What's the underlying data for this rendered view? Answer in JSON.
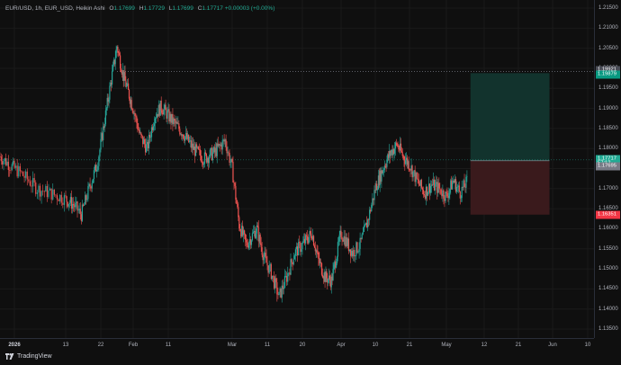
{
  "legend": {
    "symbol": "EUR/USD, 1h, EUR_USD, Heikin Ashi",
    "o_label": "O",
    "o_value": "1.17699",
    "h_label": "H",
    "h_value": "1.17729",
    "l_label": "L",
    "l_value": "1.17699",
    "c_label": "C",
    "c_value": "1.17717",
    "change": "+0.00003 (+0.00%)"
  },
  "y_ticks": [
    "1.21500",
    "1.21000",
    "1.20500",
    "1.20000",
    "1.19500",
    "1.19000",
    "1.18500",
    "1.18000",
    "1.17500",
    "1.17000",
    "1.16500",
    "1.16000",
    "1.15500",
    "1.15000",
    "1.14500",
    "1.14000",
    "1.13500"
  ],
  "x_ticks": [
    "2026",
    "13",
    "22",
    "Feb",
    "11",
    "Mar",
    "11",
    "20",
    "Apr",
    "10",
    "21",
    "May",
    "12",
    "21",
    "Jun",
    "10"
  ],
  "price_tags": {
    "target_top": "1.19921",
    "target": "1.19879",
    "current": "1.17717",
    "countdown": "57:12",
    "entry": "1.17695",
    "stop": "1.16351"
  },
  "colors": {
    "up": "#26a69a",
    "down": "#ef5350",
    "profit_zone": "#12332d",
    "loss_zone": "#3a1a1c",
    "current_tag": "#22ab94",
    "stop_tag": "#f23645",
    "entry_tag": "#787b86"
  },
  "branding": {
    "name": "TradingView"
  },
  "chart_data": {
    "type": "candlestick",
    "style": "Heikin Ashi",
    "symbol": "EUR/USD",
    "interval": "1h",
    "ylim": [
      1.135,
      1.215
    ],
    "trend_points": [
      [
        "2026-01-01",
        1.178
      ],
      [
        "2026-01-05",
        1.174
      ],
      [
        "2026-01-08",
        1.17
      ],
      [
        "2026-01-12",
        1.168
      ],
      [
        "2026-01-15",
        1.166
      ],
      [
        "2026-01-17",
        1.1635
      ],
      [
        "2026-01-19",
        1.17
      ],
      [
        "2026-01-21",
        1.176
      ],
      [
        "2026-01-23",
        1.186
      ],
      [
        "2026-01-25",
        1.196
      ],
      [
        "2026-01-27",
        1.2055
      ],
      [
        "2026-01-29",
        1.198
      ],
      [
        "2026-02-01",
        1.19
      ],
      [
        "2026-02-03",
        1.183
      ],
      [
        "2026-02-05",
        1.18
      ],
      [
        "2026-02-07",
        1.188
      ],
      [
        "2026-02-09",
        1.1905
      ],
      [
        "2026-02-12",
        1.187
      ],
      [
        "2026-02-15",
        1.184
      ],
      [
        "2026-02-18",
        1.18
      ],
      [
        "2026-02-21",
        1.1775
      ],
      [
        "2026-02-24",
        1.179
      ],
      [
        "2026-02-27",
        1.182
      ],
      [
        "2026-03-01",
        1.175
      ],
      [
        "2026-03-03",
        1.161
      ],
      [
        "2026-03-05",
        1.156
      ],
      [
        "2026-03-08",
        1.16
      ],
      [
        "2026-03-10",
        1.153
      ],
      [
        "2026-03-12",
        1.149
      ],
      [
        "2026-03-14",
        1.143
      ],
      [
        "2026-03-16",
        1.148
      ],
      [
        "2026-03-18",
        1.154
      ],
      [
        "2026-03-20",
        1.156
      ],
      [
        "2026-03-23",
        1.159
      ],
      [
        "2026-03-25",
        1.152
      ],
      [
        "2026-03-27",
        1.148
      ],
      [
        "2026-03-29",
        1.147
      ],
      [
        "2026-04-01",
        1.159
      ],
      [
        "2026-04-04",
        1.154
      ],
      [
        "2026-04-06",
        1.156
      ],
      [
        "2026-04-08",
        1.162
      ],
      [
        "2026-04-10",
        1.17
      ],
      [
        "2026-04-13",
        1.176
      ],
      [
        "2026-04-15",
        1.179
      ],
      [
        "2026-04-17",
        1.181
      ],
      [
        "2026-04-19",
        1.178
      ],
      [
        "2026-04-21",
        1.176
      ],
      [
        "2026-04-23",
        1.172
      ],
      [
        "2026-04-25",
        1.169
      ],
      [
        "2026-04-27",
        1.171
      ],
      [
        "2026-04-29",
        1.17
      ],
      [
        "2026-05-01",
        1.168
      ],
      [
        "2026-05-03",
        1.172
      ],
      [
        "2026-05-05",
        1.169
      ],
      [
        "2026-05-07",
        1.1717
      ]
    ],
    "position": {
      "type": "long",
      "entry": 1.17695,
      "target": 1.19879,
      "stop": 1.16351,
      "start": "2026-05-08",
      "end": "2026-05-31"
    },
    "hline": 1.19921
  }
}
